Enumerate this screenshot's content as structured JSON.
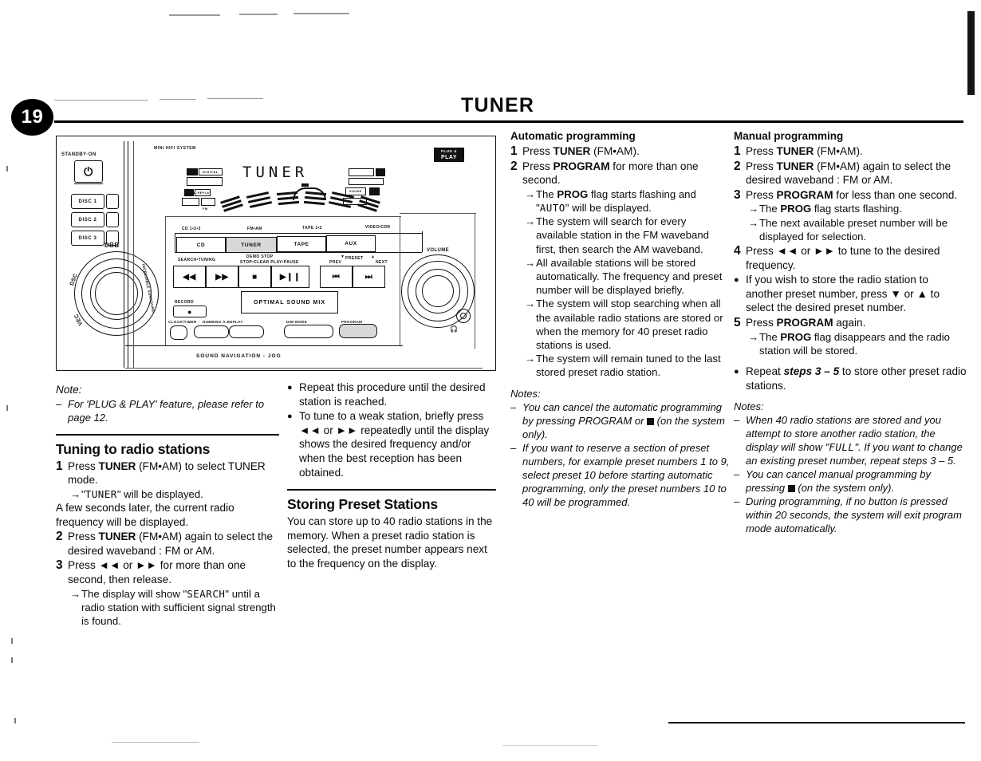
{
  "page": {
    "number": "19",
    "chapter_title": "TUNER"
  },
  "illustration": {
    "brand_text": "MINI HIFI SYSTEM",
    "standby_label": "STANDBY·ON",
    "power_icon": "power-icon",
    "disc_buttons": [
      "DISC 1",
      "DISC 2",
      "DISC 3"
    ],
    "display_text": "TUNER",
    "plug_play_badge_line1": "PLUG &",
    "plug_play_badge_line2": "PLAY",
    "source_over_labels": [
      "CD 1•2•3",
      "FM•AM",
      "TAPE 1•2",
      "VIDEO/CDR"
    ],
    "source_buttons": [
      "CD",
      "TUNER",
      "TAPE",
      "AUX"
    ],
    "volume_label": "VOLUME",
    "headphone_icon": "headphone-icon",
    "dbb_label": "DBB",
    "dsc_label": "DSC",
    "vec_label": "VEC",
    "surround_label": "INCREDIBLE SURROUND",
    "jog_label": "SOUND NAVIGATION - JOG",
    "transport_group_labels": [
      "SEARCH•TUNING",
      "DEMO STOP",
      "STOP•CLEAR PLAY•PAUSE",
      "PREV",
      "PRESET",
      "NEXT"
    ],
    "transport_icons": [
      "rewind-icon",
      "fast-forward-icon",
      "stop-icon",
      "play-pause-icon",
      "previous-icon",
      "next-icon"
    ],
    "optimal_sound_mix": "OPTIMAL SOUND MIX",
    "record_label": "RECORD",
    "bottom_row_labels": [
      "CLOCK/TIMER",
      "DUBBING A.REPLAY",
      "DIM MODE",
      "PROGRAM"
    ]
  },
  "col1": {
    "note_heading": "Note:",
    "note_dash": "–",
    "note_text": "For 'PLUG & PLAY' feature, please refer to page 12.",
    "section_title": "Tuning to radio stations",
    "steps": [
      {
        "n": "1",
        "text_pre": "Press ",
        "bold": "TUNER",
        "text_post": " (FM•AM) to select TUNER mode.",
        "arrows": [
          {
            "marker": "→",
            "pre": "\"",
            "lcd": "TUNER",
            "post": "\" will be displayed."
          }
        ]
      }
    ],
    "interlude": "A few seconds later, the current radio frequency will be displayed.",
    "step2": {
      "n": "2",
      "text_pre": "Press ",
      "bold": "TUNER",
      "text_post": " (FM•AM) again to select the desired waveband : FM or AM."
    },
    "step3": {
      "n": "3",
      "text": "Press ◄◄ or ►► for more than one second, then release.",
      "arrow_marker": "→",
      "arrow_pre": "The display will show \"",
      "arrow_lcd": "SEARCH",
      "arrow_post": "\" until a radio station with sufficient signal strength is found."
    }
  },
  "col1b": {
    "bullets": [
      {
        "b": "●",
        "text": "Repeat this procedure until the desired station is reached."
      },
      {
        "b": "●",
        "text": "To tune to a weak station, briefly press  ◄◄ or ►► repeatedly until the display shows the desired frequency and/or when the best reception has been obtained."
      }
    ],
    "section_title": "Storing Preset Stations",
    "body": "You can store up to 40 radio stations in the memory. When a preset radio station is selected, the preset number appears next to the frequency on the display."
  },
  "col2": {
    "heading": "Automatic programming",
    "step1": {
      "n": "1",
      "pre": "Press ",
      "bold": "TUNER",
      "post": " (FM•AM)."
    },
    "step2": {
      "n": "2",
      "pre": "Press ",
      "bold": "PROGRAM",
      "post": " for more than one second."
    },
    "arrows": [
      {
        "marker": "→",
        "pre": "The ",
        "bold": "PROG",
        "mid": " flag starts flashing and \"",
        "lcd": "AUTO",
        "post": "\" will be displayed."
      },
      {
        "marker": "→",
        "text": "The system will search for every available station in the FM waveband first, then search the AM waveband."
      },
      {
        "marker": "→",
        "text": "All available stations will be stored automatically. The frequency and preset number will be displayed briefly."
      },
      {
        "marker": "→",
        "text": "The system  will stop searching when all the available radio stations are stored or when the memory for 40 preset radio stations is used."
      },
      {
        "marker": "→",
        "text": "The system will remain tuned to the last stored preset radio station."
      }
    ],
    "notes_heading": "Notes:",
    "notes": [
      {
        "d": "–",
        "pre": "You can cancel the automatic programming by pressing PROGRAM or ",
        "square": true,
        "post": " (on the system only)."
      },
      {
        "d": "–",
        "pre": "If you want to reserve a section of preset numbers, for example preset numbers 1 to 9, select preset 10 before starting automatic programming, only the preset numbers 10 to 40 will be programmed."
      }
    ]
  },
  "col3": {
    "heading": "Manual programming",
    "step1": {
      "n": "1",
      "pre": "Press ",
      "bold": "TUNER",
      "post": " (FM•AM)."
    },
    "step2": {
      "n": "2",
      "pre": "Press ",
      "bold": "TUNER",
      "post": " (FM•AM) again to select the desired waveband : FM or AM."
    },
    "step3": {
      "n": "3",
      "pre": "Press ",
      "bold": "PROGRAM",
      "post": " for less than one second."
    },
    "step3_arrows": [
      {
        "marker": "→",
        "pre": "The ",
        "bold": "PROG",
        "post": " flag starts flashing."
      },
      {
        "marker": "→",
        "text": "The next available preset number will be displayed for selection."
      }
    ],
    "step4": {
      "n": "4",
      "text": "Press ◄◄ or ►► to tune to the desired frequency."
    },
    "bullet_preset": {
      "b": "●",
      "text": "If you wish to store the radio station to another preset number, press ▼ or ▲ to select the desired preset number."
    },
    "step5": {
      "n": "5",
      "pre": "Press ",
      "bold": "PROGRAM",
      "post": " again."
    },
    "step5_arrow": {
      "marker": "→",
      "pre": "The ",
      "bold": "PROG",
      "post": " flag disappears and the radio station will be stored."
    },
    "bullet_repeat": {
      "b": "●",
      "pre": "Repeat ",
      "bold": "steps 3 – 5",
      "post": " to store other preset radio stations."
    },
    "notes_heading": "Notes:",
    "notes": [
      {
        "d": "–",
        "pre": "When 40 radio stations are stored and you attempt to store another radio station, the display will show \"",
        "lcd": "FULL",
        "post": "\".  If you want to change an existing preset number, repeat steps 3 – 5."
      },
      {
        "d": "–",
        "pre": "You can cancel manual programming by pressing  ",
        "square": true,
        "post": " (on the system only)."
      },
      {
        "d": "–",
        "pre": "During programming,  if no button is pressed within 20 seconds, the system will exit program mode automatically."
      }
    ]
  }
}
